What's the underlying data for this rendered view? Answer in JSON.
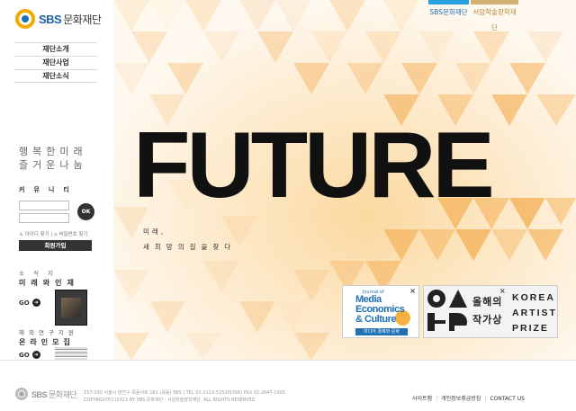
{
  "logo": {
    "en": "SBS",
    "ko": "문화재단"
  },
  "nav": {
    "items": [
      "재단소개",
      "재단사업",
      "재단소식"
    ]
  },
  "slogan": {
    "line1": "행복한미래",
    "line2": "즐거운나눔"
  },
  "login": {
    "title": "커뮤니티",
    "ok_label": "OK",
    "find_id": "아이디 찾기",
    "find_pw": "비밀번호 찾기",
    "join_label": "회원가입"
  },
  "promos": [
    {
      "sub": "소식지",
      "title": "미래와인재",
      "go": "GO"
    },
    {
      "sub": "해외연구지원",
      "title": "온라인모집",
      "go": "GO"
    }
  ],
  "top_links": [
    "SBS문화재단",
    "서암학술장학재단"
  ],
  "hero": {
    "headline": "FUTURE",
    "caption1": "미래,",
    "caption2": "새희망의길을찾다"
  },
  "banners": {
    "media": {
      "journal": "Journal of",
      "title_line1": "Media",
      "title_line2": "Economics",
      "title_line3": "& Culture",
      "footer": "미디어 경제와 문화",
      "close": "×"
    },
    "artist": {
      "ko_line1": "올해의",
      "ko_line2": "작가상",
      "en_line1": "KOREA",
      "en_line2": "ARTIST",
      "en_line3": "PRIZE",
      "close": "×"
    }
  },
  "footer": {
    "logo_en": "SBS",
    "logo_ko": "문화재단",
    "address": "157-030 서울시 양천구 목동서로 161 (목동) SBS | TEL 02-2113-5252(5356) FAX 02-2647-1505",
    "copyright": "COPYRIGHT(C)2012 BY SBS 문화재단 · 서암학술장학재단. ALL RIGHTS RESERVED.",
    "links": [
      "사이트맵",
      "개인정보취급방침",
      "CONTACT US"
    ]
  },
  "colors": {
    "brand_blue": "#1f6fb5",
    "brand_gold": "#f2a900",
    "hero_orange": "#f3a21f"
  }
}
